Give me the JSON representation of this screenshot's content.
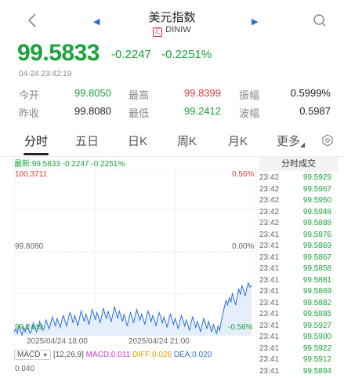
{
  "header": {
    "title": "美元指数",
    "code": "DINIW",
    "code_badge": "汇"
  },
  "quote": {
    "price": "99.5833",
    "change": "-0.2247",
    "change_pct": "-0.2251%",
    "time": "04-24 23:42:19"
  },
  "stats": [
    {
      "label": "今开",
      "value": "99.8050",
      "color": "green"
    },
    {
      "label": "最高",
      "value": "99.8399",
      "color": "red"
    },
    {
      "label": "振幅",
      "value": "0.5999%",
      "color": "black"
    },
    {
      "label": "昨收",
      "value": "99.8080",
      "color": "black"
    },
    {
      "label": "最低",
      "value": "99.2412",
      "color": "green"
    },
    {
      "label": "波幅",
      "value": "0.5987",
      "color": "black"
    }
  ],
  "tabs": [
    "分时",
    "五日",
    "日K",
    "周K",
    "月K",
    "更多"
  ],
  "latest_line": "最新:99.5833 -0.2247 -0.2251%",
  "chart_data": {
    "type": "line",
    "y_top": "100.3711",
    "y_mid": "99.8080",
    "y_bottom": "99.2449",
    "pct_top": "0.56%",
    "pct_mid": "0.00%",
    "pct_bottom": "-0.56%",
    "x_labels": [
      "2025/04/24 18:00",
      "2025/04/24 21:00"
    ],
    "ylim": [
      99.2449,
      100.3711
    ],
    "values": [
      99.27,
      99.29,
      99.26,
      99.31,
      99.28,
      99.25,
      99.3,
      99.27,
      99.32,
      99.29,
      99.26,
      99.28,
      99.33,
      99.3,
      99.27,
      99.29,
      99.34,
      99.31,
      99.28,
      99.3,
      99.35,
      99.32,
      99.29,
      99.33,
      99.37,
      99.34,
      99.31,
      99.36,
      99.33,
      99.3,
      99.35,
      99.38,
      99.34,
      99.31,
      99.36,
      99.4,
      99.37,
      99.33,
      99.38,
      99.35,
      99.31,
      99.36,
      99.41,
      99.38,
      99.34,
      99.39,
      99.36,
      99.32,
      99.37,
      99.42,
      99.39,
      99.35,
      99.4,
      99.37,
      99.33,
      99.38,
      99.43,
      99.39,
      99.36,
      99.41,
      99.37,
      99.34,
      99.39,
      99.44,
      99.4,
      99.36,
      99.41,
      99.38,
      99.34,
      99.39,
      99.35,
      99.31,
      99.36,
      99.4,
      99.37,
      99.33,
      99.38,
      99.42,
      99.38,
      99.35,
      99.39,
      99.36,
      99.32,
      99.37,
      99.41,
      99.38,
      99.34,
      99.38,
      99.35,
      99.31,
      99.36,
      99.4,
      99.37,
      99.33,
      99.37,
      99.34,
      99.3,
      99.35,
      99.39,
      99.36,
      99.32,
      99.36,
      99.33,
      99.29,
      99.34,
      99.38,
      99.35,
      99.31,
      99.35,
      99.32,
      99.28,
      99.33,
      99.37,
      99.34,
      99.3,
      99.34,
      99.31,
      99.27,
      99.32,
      99.36,
      99.33,
      99.29,
      99.34,
      99.31,
      99.27,
      99.32,
      99.29,
      99.26,
      99.31,
      99.28,
      99.34,
      99.39,
      99.44,
      99.48,
      99.45,
      99.5,
      99.47,
      99.53,
      99.49,
      99.45,
      99.51,
      99.56,
      99.52,
      99.58,
      99.55,
      99.51,
      99.56,
      99.6,
      99.57,
      99.5833
    ]
  },
  "trades_title": "分时成交",
  "trades": [
    {
      "t": "23:42",
      "p": "99.5929"
    },
    {
      "t": "23:42",
      "p": "99.5967"
    },
    {
      "t": "23:42",
      "p": "99.5950"
    },
    {
      "t": "23:42",
      "p": "99.5948"
    },
    {
      "t": "23:42",
      "p": "99.5888"
    },
    {
      "t": "23:41",
      "p": "99.5876"
    },
    {
      "t": "23:41",
      "p": "99.5869"
    },
    {
      "t": "23:41",
      "p": "99.5867"
    },
    {
      "t": "23:41",
      "p": "99.5858"
    },
    {
      "t": "23:41",
      "p": "99.5881"
    },
    {
      "t": "23:41",
      "p": "99.5869"
    },
    {
      "t": "23:41",
      "p": "99.5882"
    },
    {
      "t": "23:41",
      "p": "99.5885"
    },
    {
      "t": "23:41",
      "p": "99.5927"
    },
    {
      "t": "23:41",
      "p": "99.5900"
    },
    {
      "t": "23:41",
      "p": "99.5922"
    },
    {
      "t": "23:41",
      "p": "99.5912"
    },
    {
      "t": "23:41",
      "p": "99.5894"
    }
  ],
  "macd": {
    "selector": "MACD",
    "params": "[12,26,9]",
    "macd": "MACD:0.011",
    "diff": "DIFF:0.026",
    "dea": "DEA:0.020",
    "y_top": "0.040"
  }
}
